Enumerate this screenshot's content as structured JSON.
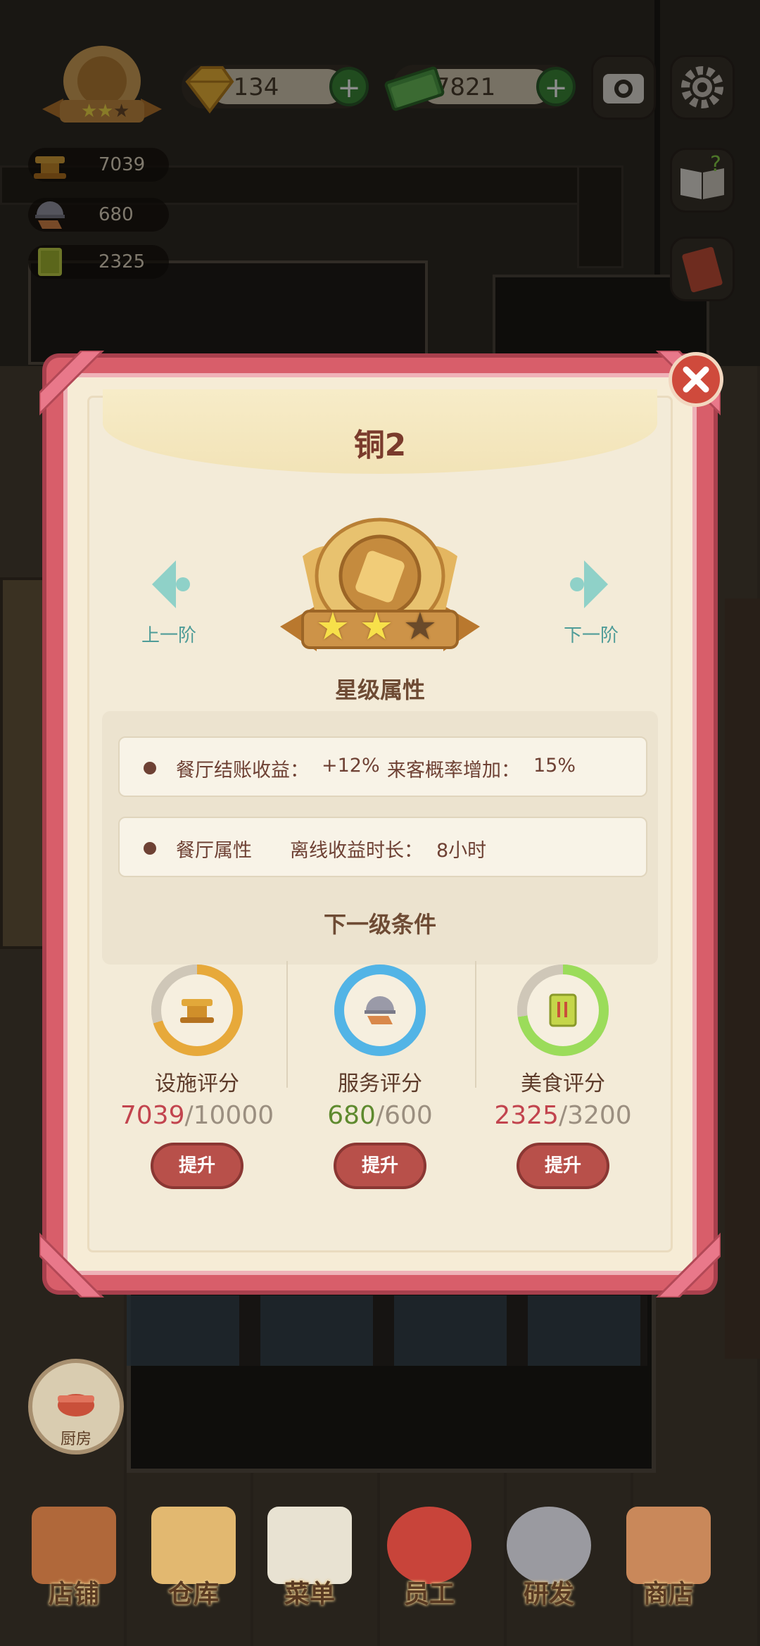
{
  "hud": {
    "stats": [
      {
        "icon": "facility-icon",
        "value": "7039"
      },
      {
        "icon": "service-icon",
        "value": "680"
      },
      {
        "icon": "food-icon",
        "value": "2325"
      }
    ],
    "gems": "134",
    "cash": "7821"
  },
  "modal": {
    "title": "铜2",
    "prev_label": "上一阶",
    "next_label": "下一阶",
    "rank_stars_filled": 2,
    "rank_stars_total": 3,
    "star_attr_title": "星级属性",
    "attr1": {
      "label": "餐厅结账收益：",
      "value": "+12%",
      "label2": "来客概率增加：",
      "value2": "15%"
    },
    "attr2": {
      "label": "餐厅属性",
      "sub_label": "离线收益时长：",
      "value": "8小时"
    },
    "next_level_title": "下一级条件",
    "requirements": [
      {
        "name": "设施评分",
        "current": "7039",
        "required": "/10000",
        "button": "提升",
        "progress": 0.7039,
        "color": "#e7a93a"
      },
      {
        "name": "服务评分",
        "current": "680",
        "required": "/600",
        "button": "提升",
        "progress": 1.0,
        "color": "#52b4e6"
      },
      {
        "name": "美食评分",
        "current": "2325",
        "required": "/3200",
        "button": "提升",
        "progress": 0.7266,
        "color": "#9bdc5a"
      }
    ]
  },
  "kitchen_label": "厨房",
  "bottom_nav": [
    {
      "label": "店铺"
    },
    {
      "label": "仓库"
    },
    {
      "label": "菜单"
    },
    {
      "label": "员工"
    },
    {
      "label": "研发"
    },
    {
      "label": "商店"
    }
  ]
}
